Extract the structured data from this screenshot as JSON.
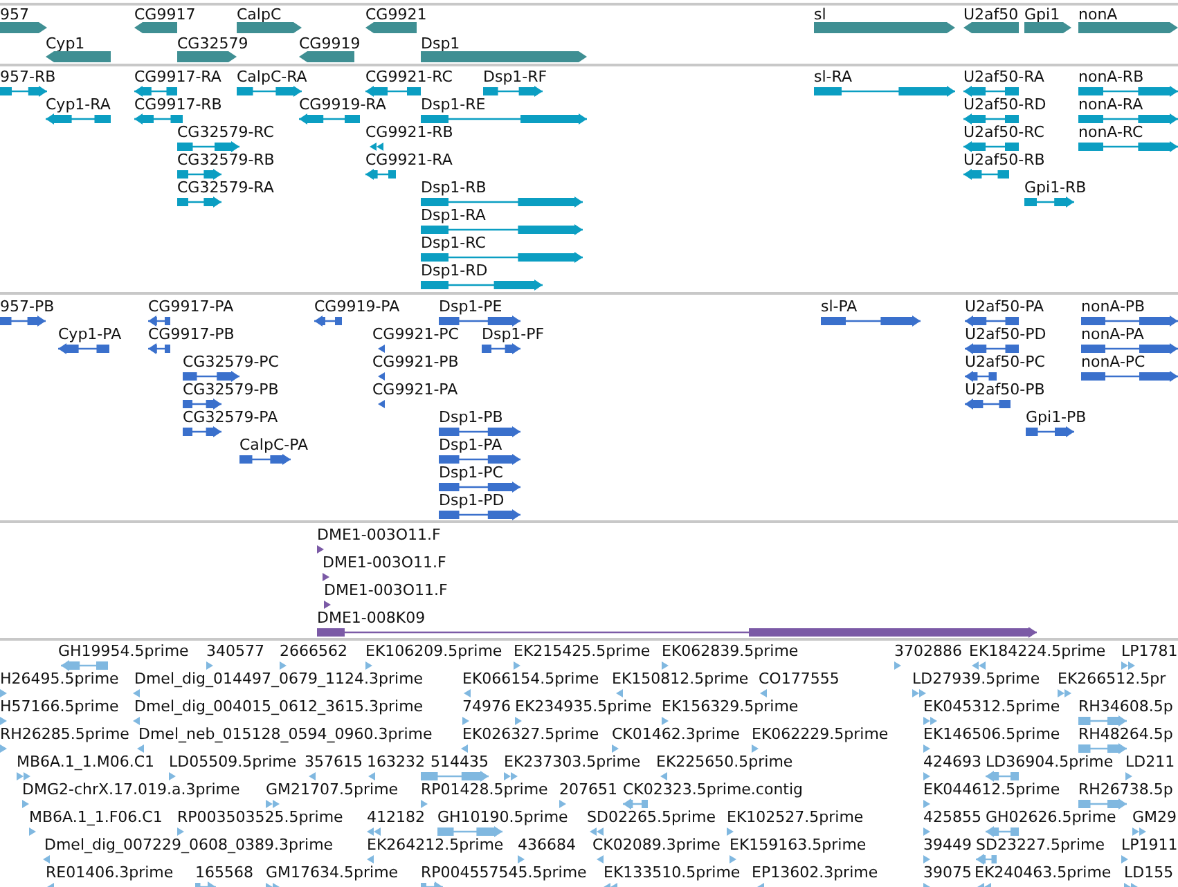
{
  "tracks": [
    {
      "kind": "gene",
      "features": [
        {
          "label": "957",
          "reverse": false
        },
        {
          "label": "CG9917",
          "reverse": true
        },
        {
          "label": "CalpC",
          "reverse": false
        },
        {
          "label": "CG9921",
          "reverse": true
        },
        {
          "label": "sl",
          "reverse": false
        },
        {
          "label": "U2af50",
          "reverse": true
        },
        {
          "label": "Gpi1",
          "reverse": false
        },
        {
          "label": "nonA",
          "reverse": false
        },
        {
          "label": "Cyp1",
          "reverse": true
        },
        {
          "label": "CG32579",
          "reverse": false
        },
        {
          "label": "CG9919",
          "reverse": true
        },
        {
          "label": "Dsp1",
          "reverse": false
        }
      ]
    },
    {
      "kind": "transcript",
      "features": [
        {
          "label": "957-RB",
          "reverse": false
        },
        {
          "label": "CG9917-RA",
          "reverse": true
        },
        {
          "label": "CalpC-RA",
          "reverse": false
        },
        {
          "label": "CG9921-RC",
          "reverse": true
        },
        {
          "label": "Dsp1-RF",
          "reverse": false
        },
        {
          "label": "sl-RA",
          "reverse": false
        },
        {
          "label": "U2af50-RA",
          "reverse": true
        },
        {
          "label": "nonA-RB",
          "reverse": false
        },
        {
          "label": "Cyp1-RA",
          "reverse": true
        },
        {
          "label": "CG9917-RB",
          "reverse": true
        },
        {
          "label": "CG9919-RA",
          "reverse": true
        },
        {
          "label": "Dsp1-RE",
          "reverse": false
        },
        {
          "label": "U2af50-RD",
          "reverse": true
        },
        {
          "label": "nonA-RA",
          "reverse": false
        },
        {
          "label": "CG32579-RC",
          "reverse": false
        },
        {
          "label": "CG9921-RB",
          "reverse": true
        },
        {
          "label": "U2af50-RC",
          "reverse": true
        },
        {
          "label": "nonA-RC",
          "reverse": false
        },
        {
          "label": "CG32579-RB",
          "reverse": false
        },
        {
          "label": "CG9921-RA",
          "reverse": true
        },
        {
          "label": "U2af50-RB",
          "reverse": true
        },
        {
          "label": "CG32579-RA",
          "reverse": false
        },
        {
          "label": "Dsp1-RB",
          "reverse": false
        },
        {
          "label": "Gpi1-RB",
          "reverse": false
        },
        {
          "label": "Dsp1-RA",
          "reverse": false
        },
        {
          "label": "Dsp1-RC",
          "reverse": false
        },
        {
          "label": "Dsp1-RD",
          "reverse": false
        }
      ]
    },
    {
      "kind": "protein",
      "features": [
        {
          "label": "957-PB",
          "reverse": false
        },
        {
          "label": "CG9917-PA",
          "reverse": true
        },
        {
          "label": "CG9919-PA",
          "reverse": true
        },
        {
          "label": "Dsp1-PE",
          "reverse": false
        },
        {
          "label": "sl-PA",
          "reverse": false
        },
        {
          "label": "U2af50-PA",
          "reverse": true
        },
        {
          "label": "nonA-PB",
          "reverse": false
        },
        {
          "label": "Cyp1-PA",
          "reverse": true
        },
        {
          "label": "CG9917-PB",
          "reverse": true
        },
        {
          "label": "CG9921-PC",
          "reverse": true
        },
        {
          "label": "Dsp1-PF",
          "reverse": false
        },
        {
          "label": "U2af50-PD",
          "reverse": true
        },
        {
          "label": "nonA-PA",
          "reverse": false
        },
        {
          "label": "CG32579-PC",
          "reverse": false
        },
        {
          "label": "CG9921-PB",
          "reverse": true
        },
        {
          "label": "U2af50-PC",
          "reverse": true
        },
        {
          "label": "nonA-PC",
          "reverse": false
        },
        {
          "label": "CG32579-PB",
          "reverse": false
        },
        {
          "label": "CG9921-PA",
          "reverse": true
        },
        {
          "label": "U2af50-PB",
          "reverse": true
        },
        {
          "label": "CG32579-PA",
          "reverse": false
        },
        {
          "label": "Dsp1-PB",
          "reverse": false
        },
        {
          "label": "Gpi1-PB",
          "reverse": false
        },
        {
          "label": "CalpC-PA",
          "reverse": false
        },
        {
          "label": "Dsp1-PA",
          "reverse": false
        },
        {
          "label": "Dsp1-PC",
          "reverse": false
        },
        {
          "label": "Dsp1-PD",
          "reverse": false
        }
      ]
    },
    {
      "kind": "clone",
      "features": [
        {
          "label": "DME1-003O11.F",
          "reverse": false
        },
        {
          "label": "DME1-003O11.F",
          "reverse": false
        },
        {
          "label": "DME1-003O11.F",
          "reverse": false
        },
        {
          "label": "DME1-008K09",
          "reverse": false
        }
      ]
    },
    {
      "kind": "est",
      "features": [
        {
          "label": "GH19954.5prime",
          "reverse": true
        },
        {
          "label": "340577",
          "reverse": false
        },
        {
          "label": "2666562",
          "reverse": false
        },
        {
          "label": "EK106209.5prime",
          "reverse": false
        },
        {
          "label": "EK215425.5prime",
          "reverse": false
        },
        {
          "label": "EK062839.5prime",
          "reverse": false
        },
        {
          "label": "3702886",
          "reverse": false
        },
        {
          "label": "EK184224.5prime",
          "reverse": true
        },
        {
          "label": "LP1781",
          "reverse": false
        },
        {
          "label": "H26495.5prime",
          "reverse": false
        },
        {
          "label": "Dmel_dig_014497_0679_1124.3prime",
          "reverse": true
        },
        {
          "label": "EK066154.5prime",
          "reverse": true
        },
        {
          "label": "EK150812.5prime",
          "reverse": true
        },
        {
          "label": "CO177555",
          "reverse": true
        },
        {
          "label": "LD27939.5prime",
          "reverse": false
        },
        {
          "label": "EK266512.5pr",
          "reverse": false
        },
        {
          "label": "H57166.5prime",
          "reverse": false
        },
        {
          "label": "Dmel_dig_004015_0612_3615.3prime",
          "reverse": true
        },
        {
          "label": "74976",
          "reverse": false
        },
        {
          "label": "EK234935.5prime",
          "reverse": false
        },
        {
          "label": "EK156329.5prime",
          "reverse": false
        },
        {
          "label": "EK045312.5prime",
          "reverse": false
        },
        {
          "label": "RH34608.5p",
          "reverse": false
        },
        {
          "label": "RH26285.5prime",
          "reverse": false
        },
        {
          "label": "Dmel_neb_015128_0594_0960.3prime",
          "reverse": true
        },
        {
          "label": "EK026327.5prime",
          "reverse": true
        },
        {
          "label": "CK01462.3prime",
          "reverse": false
        },
        {
          "label": "EK062229.5prime",
          "reverse": false
        },
        {
          "label": "EK146506.5prime",
          "reverse": false
        },
        {
          "label": "RH48264.5p",
          "reverse": false
        },
        {
          "label": "MB6A.1_1.M06.C1",
          "reverse": false
        },
        {
          "label": "LD05509.5prime",
          "reverse": false
        },
        {
          "label": "357615",
          "reverse": true
        },
        {
          "label": "163232",
          "reverse": true
        },
        {
          "label": "514435",
          "reverse": false
        },
        {
          "label": "EK237303.5prime",
          "reverse": false
        },
        {
          "label": "EK225650.5prime",
          "reverse": true
        },
        {
          "label": "424693",
          "reverse": false
        },
        {
          "label": "LD36904.5prime",
          "reverse": true
        },
        {
          "label": "LD211",
          "reverse": false
        },
        {
          "label": "DMG2-chrX.17.019.a.3prime",
          "reverse": false
        },
        {
          "label": "GM21707.5prime",
          "reverse": false
        },
        {
          "label": "RP01428.5prime",
          "reverse": false
        },
        {
          "label": "207651",
          "reverse": false
        },
        {
          "label": "CK02323.5prime.contig",
          "reverse": true
        },
        {
          "label": "EK044612.5prime",
          "reverse": false
        },
        {
          "label": "RH26738.5p",
          "reverse": false
        },
        {
          "label": "MB6A.1_1.F06.C1",
          "reverse": false
        },
        {
          "label": "RP003503525.5prime",
          "reverse": false
        },
        {
          "label": "412182",
          "reverse": true
        },
        {
          "label": "GH10190.5prime",
          "reverse": false
        },
        {
          "label": "SD02265.5prime",
          "reverse": true
        },
        {
          "label": "EK102527.5prime",
          "reverse": false
        },
        {
          "label": "425855",
          "reverse": false
        },
        {
          "label": "GH02626.5prime",
          "reverse": true
        },
        {
          "label": "GM29",
          "reverse": false
        },
        {
          "label": "Dmel_dig_007229_0608_0389.3prime",
          "reverse": true
        },
        {
          "label": "EK264212.5prime",
          "reverse": true
        },
        {
          "label": "436684",
          "reverse": false
        },
        {
          "label": "CK02089.3prime",
          "reverse": true
        },
        {
          "label": "EK159163.5prime",
          "reverse": false
        },
        {
          "label": "39449",
          "reverse": false
        },
        {
          "label": "SD23227.5prime",
          "reverse": true
        },
        {
          "label": "LP1911",
          "reverse": false
        },
        {
          "label": "RE01406.3prime",
          "reverse": true
        },
        {
          "label": "165568",
          "reverse": false
        },
        {
          "label": "GM17634.5prime",
          "reverse": false
        },
        {
          "label": "RP004557545.5prime",
          "reverse": false
        },
        {
          "label": "EK133510.5prime",
          "reverse": true
        },
        {
          "label": "EP13602.3prime",
          "reverse": true
        },
        {
          "label": "39075",
          "reverse": false
        },
        {
          "label": "EK240463.5prime",
          "reverse": true
        },
        {
          "label": "LD155",
          "reverse": false
        }
      ]
    }
  ]
}
